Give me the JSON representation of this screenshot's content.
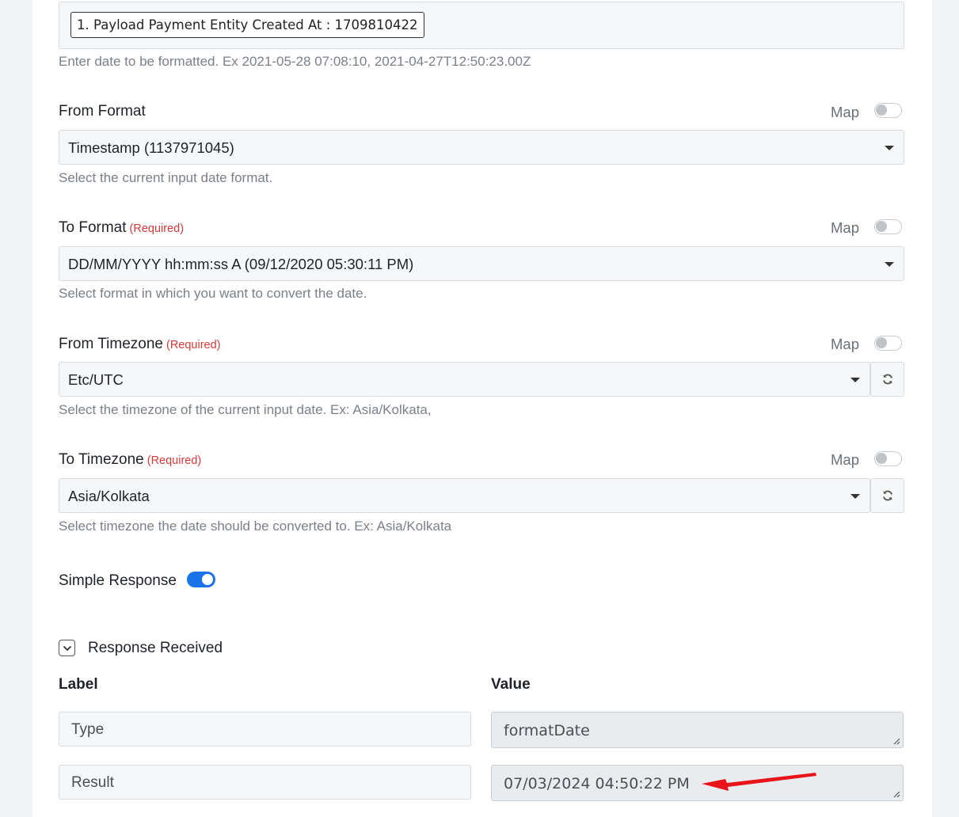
{
  "payload": {
    "chip_text": "1. Payload Payment Entity Created At : 1709810422",
    "help": "Enter date to be formatted. Ex 2021-05-28 07:08:10, 2021-04-27T12:50:23.00Z"
  },
  "map_label": "Map",
  "required_text": "(Required)",
  "from_format": {
    "label": "From Format",
    "value": "Timestamp (1137971045)",
    "help": "Select the current input date format."
  },
  "to_format": {
    "label": "To Format",
    "value": "DD/MM/YYYY hh:mm:ss A (09/12/2020 05:30:11 PM)",
    "help": "Select format in which you want to convert the date."
  },
  "from_timezone": {
    "label": "From Timezone",
    "value": "Etc/UTC",
    "help": "Select the timezone of the current input date. Ex: Asia/Kolkata,"
  },
  "to_timezone": {
    "label": "To Timezone",
    "value": "Asia/Kolkata",
    "help": "Select timezone the date should be converted to. Ex: Asia/Kolkata"
  },
  "simple_response": {
    "label": "Simple Response",
    "enabled": true
  },
  "response": {
    "title": "Response Received",
    "col_label": "Label",
    "col_value": "Value",
    "rows": [
      {
        "label": "Type",
        "value": "formatDate"
      },
      {
        "label": "Result",
        "value": "07/03/2024 04:50:22 PM"
      }
    ]
  },
  "colors": {
    "accent": "#1a73e8",
    "required": "#d43a3a",
    "annotation_arrow": "#e8141a"
  },
  "icons": [
    "chevron-down-icon",
    "refresh-icon",
    "resize-grip-icon",
    "red-arrow-annotation"
  ]
}
